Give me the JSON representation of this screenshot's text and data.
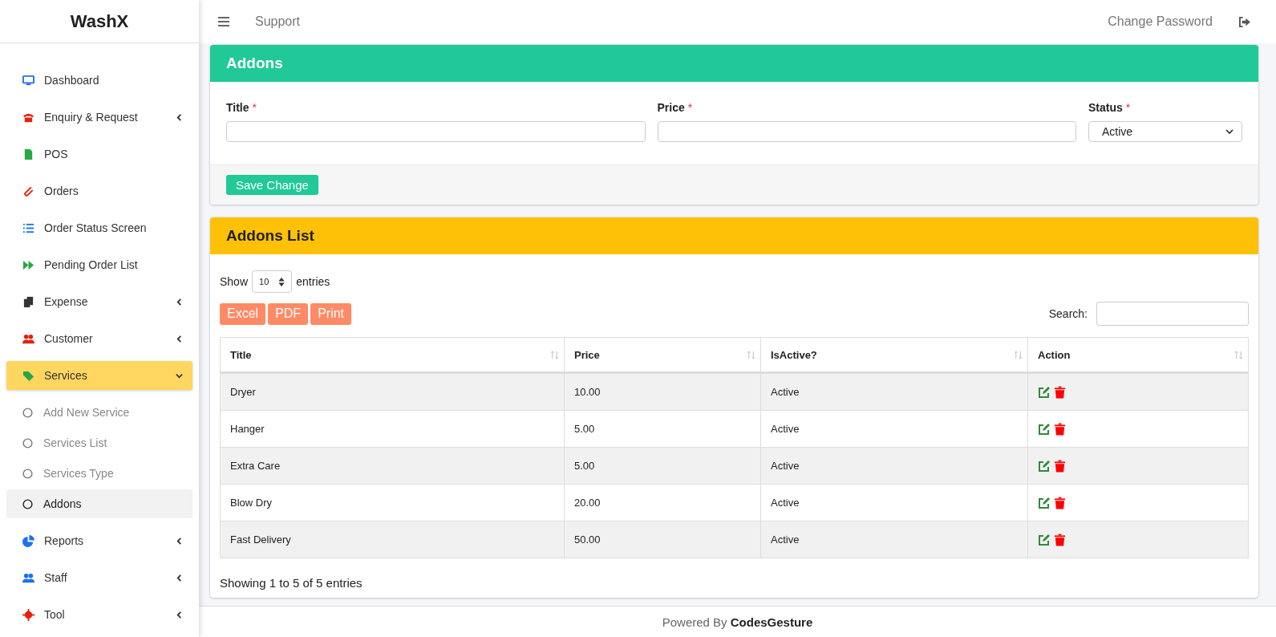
{
  "brand": "WashX",
  "topbar": {
    "link": "Support",
    "change_password": "Change Password"
  },
  "sidebar": {
    "items": [
      {
        "label": "Dashboard",
        "kind": "link",
        "selected": false
      },
      {
        "label": "Enquiry & Request",
        "kind": "menu",
        "expanded": false,
        "selected": false
      },
      {
        "label": "POS",
        "kind": "link",
        "selected": false
      },
      {
        "label": "Orders",
        "kind": "link",
        "selected": false
      },
      {
        "label": "Order Status Screen",
        "kind": "link",
        "selected": false
      },
      {
        "label": "Pending Order List",
        "kind": "link",
        "selected": false
      },
      {
        "label": "Expense",
        "kind": "menu",
        "expanded": false,
        "selected": false
      },
      {
        "label": "Customer",
        "kind": "menu",
        "expanded": false,
        "selected": false
      },
      {
        "label": "Services",
        "kind": "menu",
        "expanded": true,
        "selected": true,
        "children": [
          {
            "label": "Add New Service",
            "selected": false
          },
          {
            "label": "Services List",
            "selected": false
          },
          {
            "label": "Services Type",
            "selected": false
          },
          {
            "label": "Addons",
            "selected": true
          }
        ]
      },
      {
        "label": "Reports",
        "kind": "menu",
        "expanded": false,
        "selected": false
      },
      {
        "label": "Staff",
        "kind": "menu",
        "expanded": false,
        "selected": false
      },
      {
        "label": "Tool",
        "kind": "menu",
        "expanded": false,
        "selected": false
      }
    ]
  },
  "form_card": {
    "title": "Addons",
    "fields": [
      {
        "label": "Title",
        "required_mark": "*",
        "kind": "text"
      },
      {
        "label": "Price",
        "required_mark": "*",
        "kind": "text"
      },
      {
        "label": "Status",
        "required_mark": "*",
        "kind": "select",
        "value": "Active"
      }
    ],
    "button": "Save Change"
  },
  "list_card": {
    "title": "Addons List",
    "length": {
      "before": "Show",
      "value": "10",
      "after": "entries"
    },
    "export_buttons": [
      "Excel",
      "PDF",
      "Print"
    ],
    "search_label": "Search:",
    "table": {
      "columns": [
        "Title",
        "Price",
        "IsActive?",
        "Action"
      ],
      "rows": [
        [
          "Dryer",
          "10.00",
          "Active"
        ],
        [
          "Hanger",
          "5.00",
          "Active"
        ],
        [
          "Extra Care",
          "5.00",
          "Active"
        ],
        [
          "Blow Dry",
          "20.00",
          "Active"
        ],
        [
          "Fast Delivery",
          "50.00",
          "Active"
        ]
      ]
    },
    "info": "Showing 1 to 5 of 5 entries"
  },
  "footer": "Powered By **CodesGesture**"
}
